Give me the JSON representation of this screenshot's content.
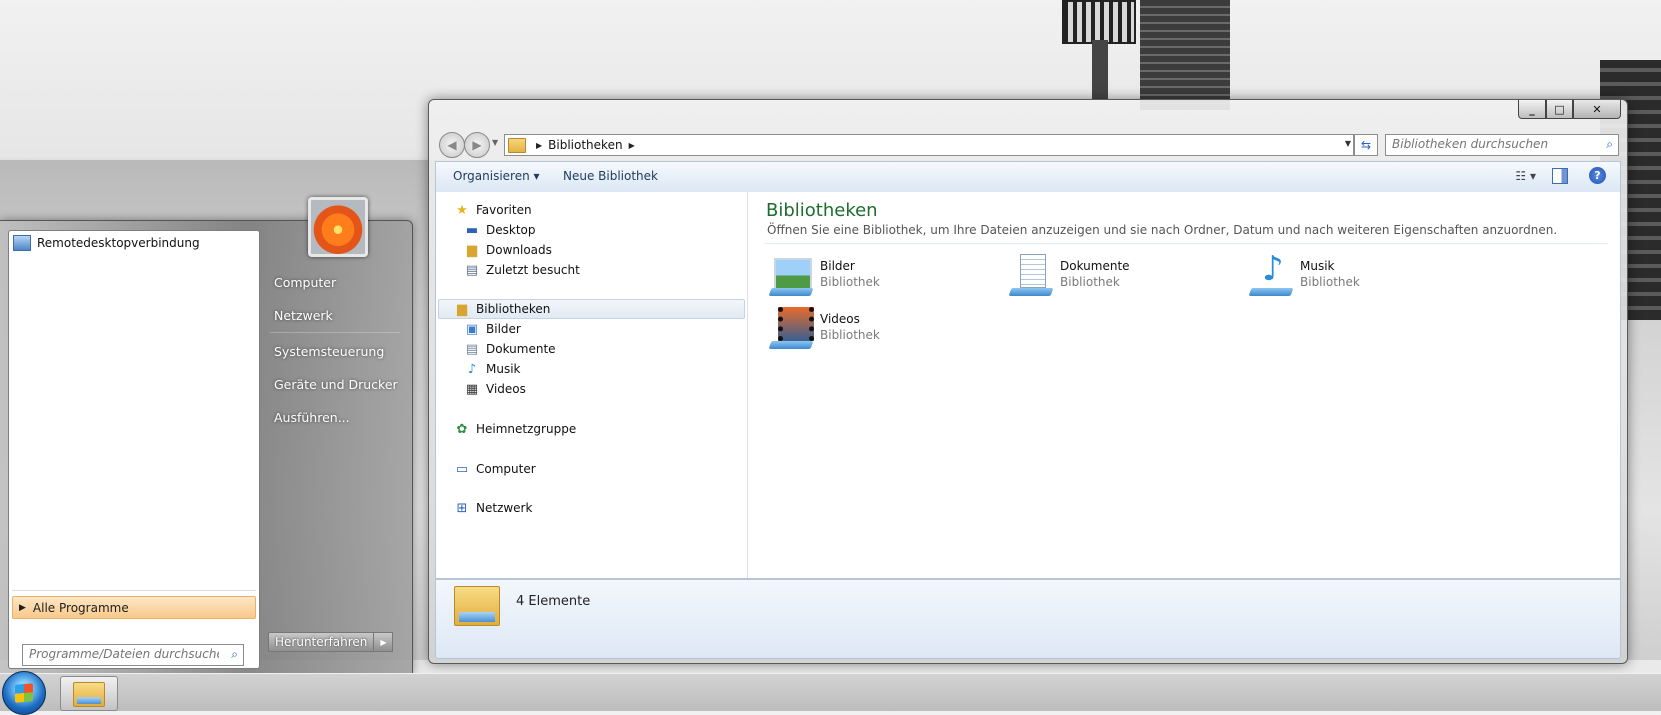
{
  "explorer": {
    "address": {
      "path": "Bibliotheken"
    },
    "search_placeholder": "Bibliotheken durchsuchen",
    "toolbar": {
      "organize": "Organisieren",
      "new_library": "Neue Bibliothek",
      "help": "?"
    },
    "tree": {
      "favorites": "Favoriten",
      "desktop": "Desktop",
      "downloads": "Downloads",
      "recent": "Zuletzt besucht",
      "libraries": "Bibliotheken",
      "pictures": "Bilder",
      "documents": "Dokumente",
      "music": "Musik",
      "videos": "Videos",
      "homegroup": "Heimnetzgruppe",
      "computer": "Computer",
      "network": "Netzwerk"
    },
    "content": {
      "title": "Bibliotheken",
      "subtitle": "Öffnen Sie eine Bibliothek, um Ihre Dateien anzuzeigen und sie nach Ordner, Datum und nach weiteren Eigenschaften anzuordnen.",
      "libraries": [
        {
          "name": "Bilder",
          "type": "Bibliothek"
        },
        {
          "name": "Dokumente",
          "type": "Bibliothek"
        },
        {
          "name": "Musik",
          "type": "Bibliothek"
        },
        {
          "name": "Videos",
          "type": "Bibliothek"
        }
      ]
    },
    "status": {
      "count": "4 Elemente"
    }
  },
  "start_menu": {
    "pinned": [
      "Remotedesktopverbindung"
    ],
    "all_programs": "Alle Programme",
    "search_placeholder": "Programme/Dateien durchsuchen",
    "right": {
      "computer": "Computer",
      "network": "Netzwerk",
      "control_panel": "Systemsteuerung",
      "devices": "Geräte und Drucker",
      "run": "Ausführen..."
    },
    "shutdown": "Herunterfahren"
  }
}
